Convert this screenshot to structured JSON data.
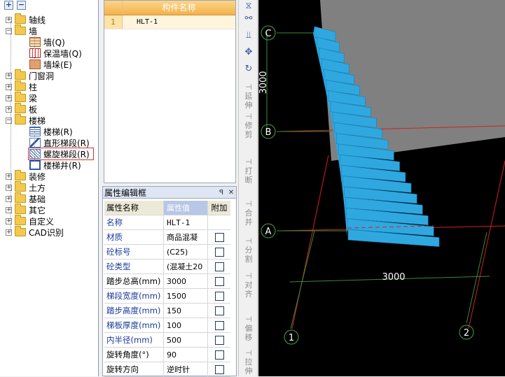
{
  "tree": {
    "toolbar": [
      "+",
      "−"
    ],
    "nodes": [
      {
        "label": "轴线",
        "level": 0,
        "type": "folder",
        "expanded": false
      },
      {
        "label": "墙",
        "level": 0,
        "type": "folder",
        "expanded": true
      },
      {
        "label": "墙(Q)",
        "level": 1,
        "type": "wall"
      },
      {
        "label": "保温墙(Q)",
        "level": 1,
        "type": "ins"
      },
      {
        "label": "墙垛(E)",
        "level": 1,
        "type": "pier"
      },
      {
        "label": "门窗洞",
        "level": 0,
        "type": "folder",
        "expanded": false
      },
      {
        "label": "柱",
        "level": 0,
        "type": "folder",
        "expanded": false
      },
      {
        "label": "梁",
        "level": 0,
        "type": "folder",
        "expanded": false
      },
      {
        "label": "板",
        "level": 0,
        "type": "folder",
        "expanded": false
      },
      {
        "label": "楼梯",
        "level": 0,
        "type": "folder",
        "expanded": true
      },
      {
        "label": "楼梯(R)",
        "level": 1,
        "type": "stair"
      },
      {
        "label": "直形梯段(R)",
        "level": 1,
        "type": "ramp"
      },
      {
        "label": "螺旋梯段(R)",
        "level": 1,
        "type": "spiral",
        "selected": true
      },
      {
        "label": "楼梯井(R)",
        "level": 1,
        "type": "well"
      },
      {
        "label": "装修",
        "level": 0,
        "type": "folder",
        "expanded": false
      },
      {
        "label": "土方",
        "level": 0,
        "type": "folder",
        "expanded": false
      },
      {
        "label": "基础",
        "level": 0,
        "type": "folder",
        "expanded": false
      },
      {
        "label": "其它",
        "level": 0,
        "type": "folder",
        "expanded": false
      },
      {
        "label": "自定义",
        "level": 0,
        "type": "folder",
        "expanded": false
      },
      {
        "label": "CAD识别",
        "level": 0,
        "type": "folder",
        "expanded": false
      }
    ]
  },
  "component_list": {
    "header": "构件名称",
    "rows": [
      {
        "index": "1",
        "name": "HLT-1"
      }
    ]
  },
  "properties": {
    "title": "属性编辑框",
    "pin": "ꟼ",
    "close": "✕",
    "headers": {
      "name": "属性名称",
      "value": "属性值",
      "extra": "附加"
    },
    "rows": [
      {
        "name": "名称",
        "value": "HLT-1",
        "blue": true,
        "check": false
      },
      {
        "name": "材质",
        "value": "商品混凝",
        "blue": true,
        "check": true
      },
      {
        "name": "砼标号",
        "value": "(C25)",
        "blue": true,
        "check": true
      },
      {
        "name": "砼类型",
        "value": "(混凝土20",
        "blue": true,
        "check": true
      },
      {
        "name": "踏步总高(mm)",
        "value": "3000",
        "blue": false,
        "check": true
      },
      {
        "name": "梯段宽度(mm)",
        "value": "1500",
        "blue": true,
        "check": true
      },
      {
        "name": "踏步高度(mm)",
        "value": "150",
        "blue": true,
        "check": true
      },
      {
        "name": "梯板厚度(mm)",
        "value": "100",
        "blue": true,
        "check": true
      },
      {
        "name": "内半径(mm)",
        "value": "500",
        "blue": true,
        "check": true
      },
      {
        "name": "旋转角度(°)",
        "value": "90",
        "blue": false,
        "check": true
      },
      {
        "name": "旋转方向",
        "value": "逆时针",
        "blue": false,
        "check": true
      }
    ]
  },
  "toolbar": {
    "buttons": [
      {
        "name": "extend",
        "label": "延伸"
      },
      {
        "name": "trim",
        "label": "修剪"
      },
      {
        "name": "break",
        "label": "打断"
      },
      {
        "name": "merge",
        "label": "合并"
      },
      {
        "name": "split",
        "label": "分割"
      },
      {
        "name": "align",
        "label": "对齐"
      },
      {
        "name": "offset",
        "label": "偏移"
      },
      {
        "name": "stretch",
        "label": "拉伸"
      }
    ]
  },
  "canvas": {
    "axes": {
      "c": "C",
      "b": "B",
      "a": "A",
      "one": "1",
      "two": "2"
    },
    "dims": {
      "vertical": "3000",
      "horizontal": "3000"
    },
    "colors": {
      "stair": "#2fa8e0",
      "axis": "#3a8a3a",
      "grid": "#d22020",
      "plane": "#808080"
    }
  }
}
